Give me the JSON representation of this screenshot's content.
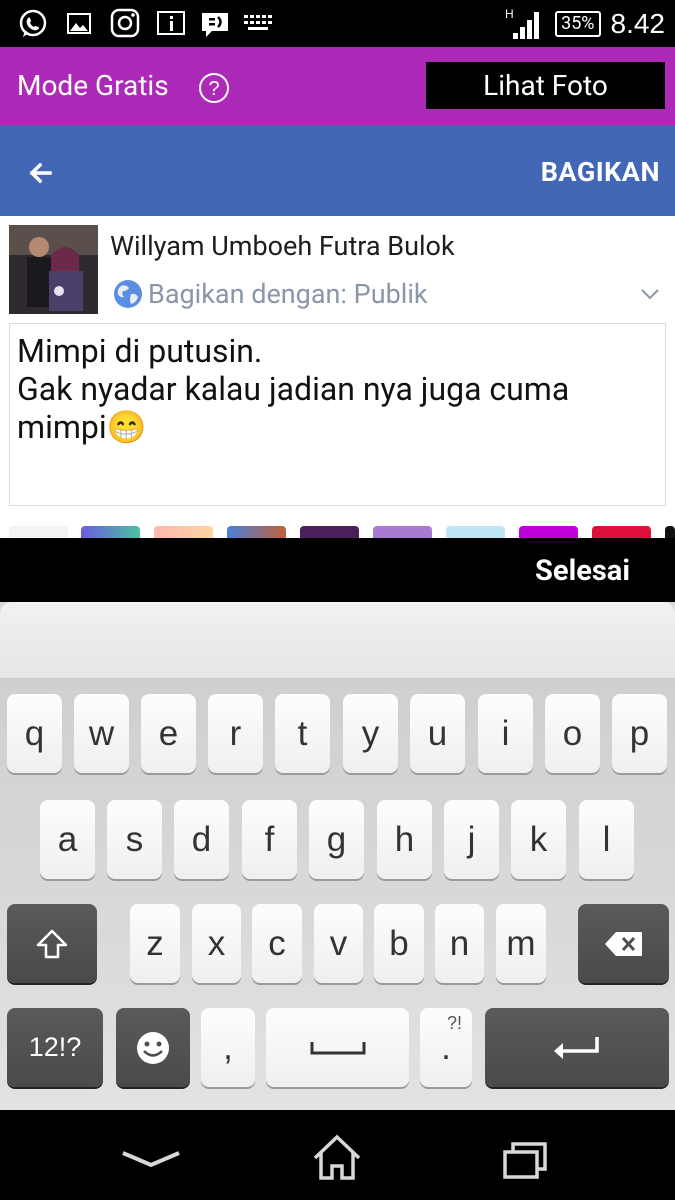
{
  "status_bar": {
    "battery": "35%",
    "time": "8.42",
    "network": "H",
    "icons": [
      "whatsapp-icon",
      "gallery-icon",
      "instagram-icon",
      "info-icon",
      "chat-icon",
      "keyboard-icon"
    ]
  },
  "free_bar": {
    "title": "Mode Gratis",
    "view_photo": "Lihat Foto"
  },
  "top_bar": {
    "share_label": "BAGIKAN"
  },
  "composer": {
    "user_name": "Willyam Umboeh Futra Bulok",
    "privacy_label": "Bagikan dengan:",
    "privacy_value": "Publik",
    "post_text": "Mimpi di putusin.\nGak nyadar kalau jadian nya juga cuma mimpi",
    "post_emoji": "😁"
  },
  "keyboard_header": {
    "done_label": "Selesai"
  },
  "keyboard": {
    "row1": [
      "q",
      "w",
      "e",
      "r",
      "t",
      "y",
      "u",
      "i",
      "o",
      "p"
    ],
    "row2": [
      "a",
      "s",
      "d",
      "f",
      "g",
      "h",
      "j",
      "k",
      "l"
    ],
    "row3": [
      "z",
      "x",
      "c",
      "v",
      "b",
      "n",
      "m"
    ],
    "symbols_label": "12!?",
    "comma_label": ",",
    "period_label": ".",
    "period_sub": "?!"
  },
  "colors": {
    "free_bar": "#ad2ab8",
    "top_bar": "#4167b5"
  }
}
